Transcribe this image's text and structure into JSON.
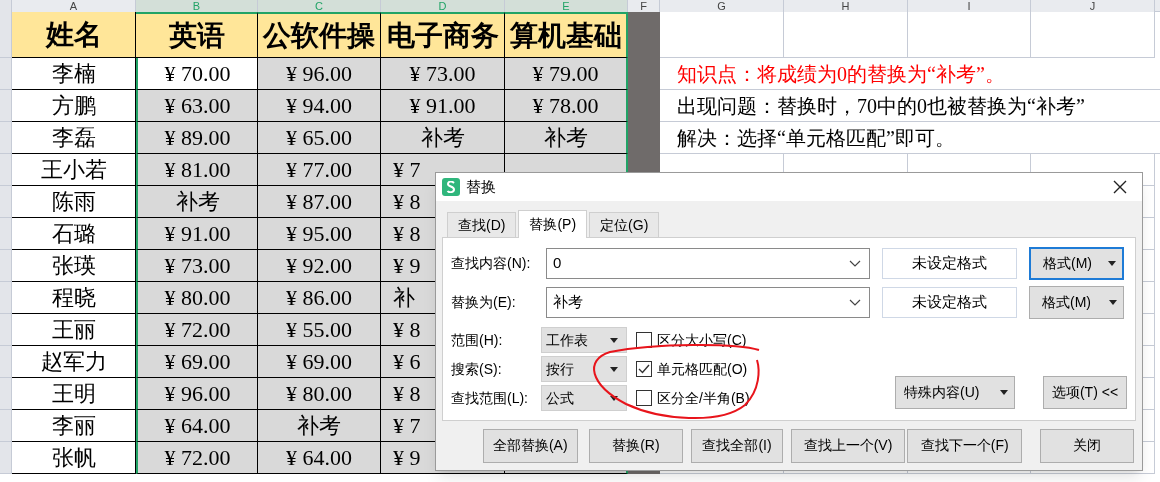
{
  "sheet": {
    "column_headers": [
      {
        "label": "A",
        "selected": false
      },
      {
        "label": "B",
        "selected": true
      },
      {
        "label": "C",
        "selected": true
      },
      {
        "label": "D",
        "selected": true
      },
      {
        "label": "E",
        "selected": true
      },
      {
        "label": "F",
        "selected": false
      },
      {
        "label": "G",
        "selected": false
      },
      {
        "label": "H",
        "selected": false
      },
      {
        "label": "I",
        "selected": false
      },
      {
        "label": "J",
        "selected": false
      }
    ],
    "header_row": [
      "姓名",
      "英语",
      "公软件操",
      "电子商务",
      "算机基础"
    ],
    "rows": [
      {
        "name": "李楠",
        "cells": [
          {
            "text": "¥ 70.00",
            "active": true
          },
          {
            "text": "¥ 96.00",
            "active": false
          },
          {
            "text": "¥ 73.00",
            "active": false
          },
          {
            "text": "¥ 79.00",
            "active": false
          }
        ]
      },
      {
        "name": "方鹏",
        "cells": [
          {
            "text": "¥ 63.00",
            "active": false
          },
          {
            "text": "¥ 94.00",
            "active": false
          },
          {
            "text": "¥ 91.00",
            "active": false
          },
          {
            "text": "¥ 78.00",
            "active": false
          }
        ]
      },
      {
        "name": "李磊",
        "cells": [
          {
            "text": "¥ 89.00",
            "active": false
          },
          {
            "text": "¥ 65.00",
            "active": false
          },
          {
            "text": "补考",
            "active": false
          },
          {
            "text": "补考",
            "active": false
          }
        ]
      },
      {
        "name": "王小若",
        "cells": [
          {
            "text": "¥ 81.00",
            "active": false
          },
          {
            "text": "¥ 77.00",
            "active": false
          },
          {
            "text": "¥ 7",
            "active": false,
            "partial": true
          }
        ]
      },
      {
        "name": "陈雨",
        "cells": [
          {
            "text": "补考",
            "active": false
          },
          {
            "text": "¥ 87.00",
            "active": false
          },
          {
            "text": "¥ 8",
            "active": false,
            "partial": true
          }
        ]
      },
      {
        "name": "石璐",
        "cells": [
          {
            "text": "¥ 91.00",
            "active": false
          },
          {
            "text": "¥ 95.00",
            "active": false
          },
          {
            "text": "¥ 8",
            "active": false,
            "partial": true
          }
        ]
      },
      {
        "name": "张瑛",
        "cells": [
          {
            "text": "¥ 73.00",
            "active": false
          },
          {
            "text": "¥ 92.00",
            "active": false
          },
          {
            "text": "¥ 9",
            "active": false,
            "partial": true
          }
        ]
      },
      {
        "name": "程晓",
        "cells": [
          {
            "text": "¥ 80.00",
            "active": false
          },
          {
            "text": "¥ 86.00",
            "active": false
          },
          {
            "text": "补",
            "active": false,
            "partial": true
          }
        ]
      },
      {
        "name": "王丽",
        "cells": [
          {
            "text": "¥ 72.00",
            "active": false
          },
          {
            "text": "¥ 55.00",
            "active": false
          },
          {
            "text": "¥ 8",
            "active": false,
            "partial": true
          }
        ]
      },
      {
        "name": "赵军力",
        "cells": [
          {
            "text": "¥ 69.00",
            "active": false
          },
          {
            "text": "¥ 69.00",
            "active": false
          },
          {
            "text": "¥ 6",
            "active": false,
            "partial": true
          }
        ]
      },
      {
        "name": "王明",
        "cells": [
          {
            "text": "¥ 96.00",
            "active": false
          },
          {
            "text": "¥ 80.00",
            "active": false
          },
          {
            "text": "¥ 8",
            "active": false,
            "partial": true
          }
        ]
      },
      {
        "name": "李丽",
        "cells": [
          {
            "text": "¥ 64.00",
            "active": false
          },
          {
            "text": "补考",
            "active": false
          },
          {
            "text": "¥ 7",
            "active": false,
            "partial": true
          }
        ]
      },
      {
        "name": "张帆",
        "cells": [
          {
            "text": "¥ 72.00",
            "active": false
          },
          {
            "text": "¥ 64.00",
            "active": false
          },
          {
            "text": "¥ 9",
            "active": false,
            "partial": true
          }
        ]
      }
    ]
  },
  "notes": [
    {
      "text": "知识点：将成绩为0的替换为“补考”。",
      "kind": "highlight"
    },
    {
      "text": "出现问题：替换时，70中的0也被替换为“补考”",
      "kind": "plain"
    },
    {
      "text": "解决：选择“单元格匹配”即可。",
      "kind": "plain"
    }
  ],
  "dialog": {
    "title": "替换",
    "tabs": [
      {
        "label": "查找(D)",
        "selected": false
      },
      {
        "label": "替换(P)",
        "selected": true
      },
      {
        "label": "定位(G)",
        "selected": false
      }
    ],
    "fields": [
      {
        "label": "查找内容(N):",
        "value": "0",
        "format_status": "未设定格式",
        "format_button": "格式(M)",
        "focused": true
      },
      {
        "label": "替换为(E):",
        "value": "补考",
        "format_status": "未设定格式",
        "format_button": "格式(M)",
        "focused": false
      }
    ],
    "options": [
      {
        "label": "范围(H):",
        "value": "工作表",
        "checkbox": {
          "label": "区分大小写(C)",
          "checked": false
        }
      },
      {
        "label": "搜索(S):",
        "value": "按行",
        "checkbox": {
          "label": "单元格匹配(O)",
          "checked": true
        }
      },
      {
        "label": "查找范围(L):",
        "value": "公式",
        "checkbox": {
          "label": "区分全/半角(B)",
          "checked": false
        }
      }
    ],
    "side_buttons": [
      {
        "label": "特殊内容(U)",
        "dropdown": true
      },
      {
        "label": "选项(T) <<",
        "dropdown": false
      }
    ],
    "buttons": [
      "全部替换(A)",
      "替换(R)",
      "查找全部(I)",
      "查找上一个(V)",
      "查找下一个(F)",
      "关闭"
    ]
  }
}
